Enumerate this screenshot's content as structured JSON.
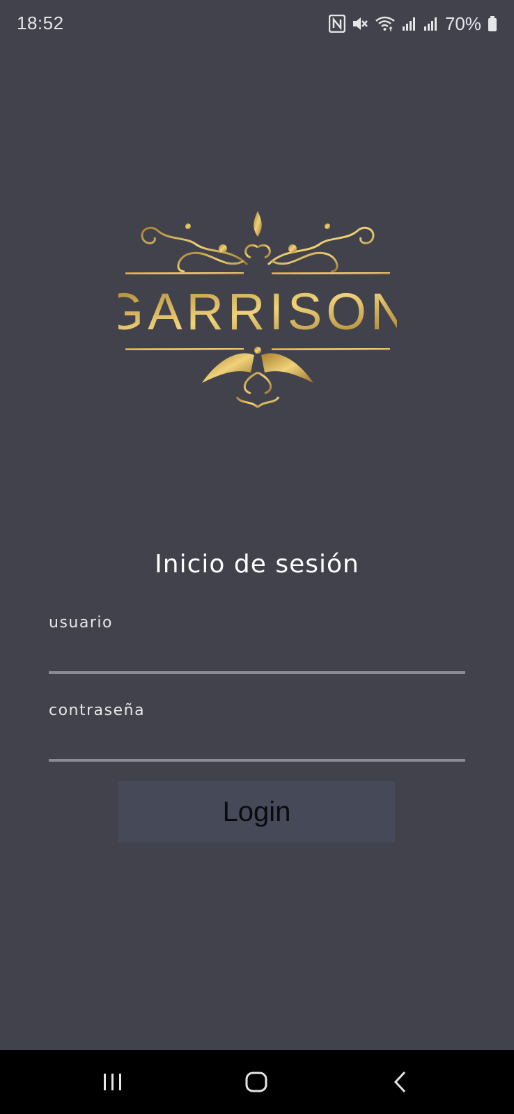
{
  "status_bar": {
    "time": "18:52",
    "battery_percent": "70%",
    "icons": [
      "nfc-icon",
      "mute-icon",
      "wifi-icon",
      "signal-icon",
      "signal-icon",
      "battery-icon"
    ]
  },
  "logo": {
    "text": "GARRISON",
    "icon": "ornamental-crest-icon",
    "color": "#c9a24a"
  },
  "login": {
    "title": "Inicio de sesión",
    "username_label": "usuario",
    "username_value": "",
    "password_label": "contraseña",
    "password_value": "",
    "button_label": "Login"
  },
  "nav_bar": {
    "buttons": [
      "recent-apps-icon",
      "home-icon",
      "back-icon"
    ]
  },
  "colors": {
    "background": "#41424b",
    "input_underline": "#8a8b90",
    "button_bg": "#464958",
    "gold": "#c9a24a"
  }
}
